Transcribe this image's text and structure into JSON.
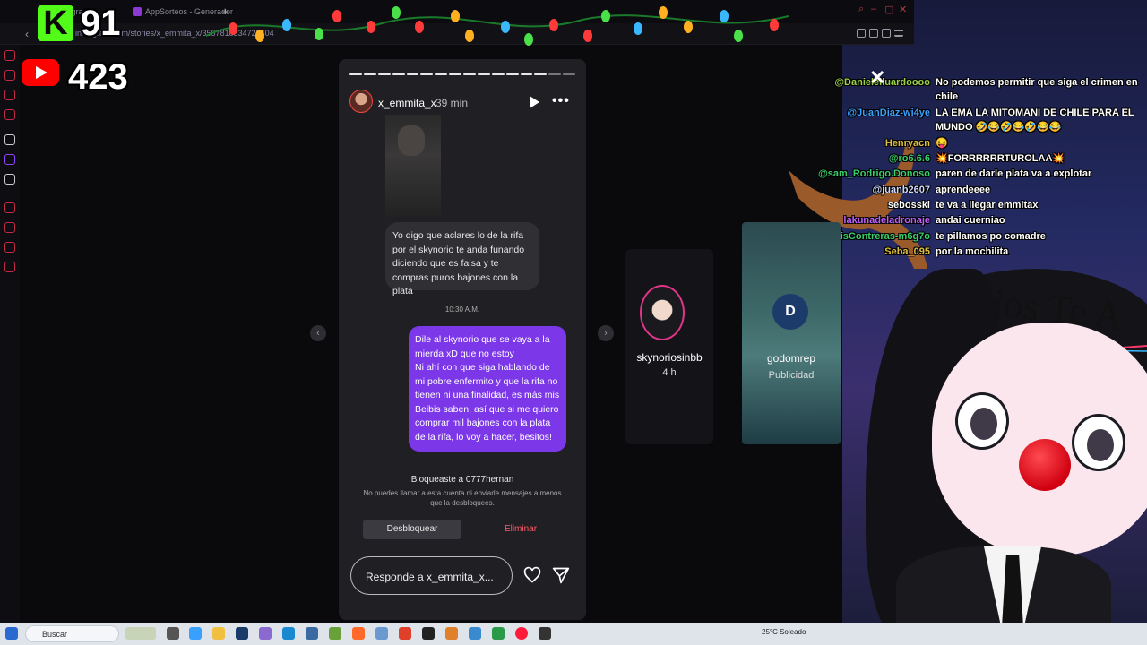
{
  "browser": {
    "tabs": [
      {
        "label": "Instagram"
      },
      {
        "label": "AppSorteos - Generador"
      }
    ],
    "url": "instagram.com/stories/x_emmita_x/3567818334725404"
  },
  "overlay": {
    "kick_logo": "K",
    "kick_count": "91",
    "youtube_count": "423"
  },
  "story": {
    "username": "x_emmita_x",
    "time_ago": "39 min",
    "incoming_message": "Yo digo que aclares lo de la rifa por el skynorio te anda funando diciendo que es falsa y te compras puros bajones con la plata",
    "message_time": "10:30 A.M.",
    "outgoing_message_1": "Dile al skynorio que se vaya a la mierda xD que no estoy",
    "outgoing_message_2": "Ni ahí con que siga hablando de mi pobre enfermito y que la rifa no tienen ni una finalidad, es más mis Beibis saben, así que si me quiero comprar mil bajones con la plata de la rifa, lo voy a hacer, besitos!",
    "blocked_title": "Bloqueaste a 0777hernan",
    "blocked_desc": "No puedes llamar a esta cuenta ni enviarle mensajes a menos que la desbloquees.",
    "unblock_label": "Desbloquear",
    "delete_label": "Eliminar",
    "reply_placeholder": "Responde a x_emmita_x...",
    "progress_segments": 16,
    "progress_watched": 14
  },
  "next_stories": [
    {
      "name": "skynoriosinbb",
      "sub": "4 h"
    },
    {
      "name": "godomrep",
      "sub": "Publicidad",
      "logo": "D"
    }
  ],
  "stream": {
    "banner_text": "Dios Te A"
  },
  "chat": [
    {
      "user": "@Danielelluardoooo",
      "color": "#9ad14a",
      "msg": "No podemos permitir que siga el crimen en chile"
    },
    {
      "user": "@JuanDiaz-wi4ye",
      "color": "#3aa0ff",
      "msg": "LA EMA LA MITOMANI DE CHILE PARA EL MUNDO 🤣😂🤣😂🤣😂😂"
    },
    {
      "user": "Henryacn",
      "color": "#e0c040",
      "msg": "😝"
    },
    {
      "user": "@ro6.6.6",
      "color": "#3acf6a",
      "msg": "💥FORRRRRRTUROLAA💥"
    },
    {
      "user": "@sam_Rodrigo.Donoso",
      "color": "#3acf6a",
      "msg": "paren de darle plata va a explotar"
    },
    {
      "user": "@juanb2607",
      "color": "#cfd8ff",
      "msg": "aprendeeee"
    },
    {
      "user": "sebosski",
      "color": "#ffffff",
      "msg": "te va a llegar emmitax"
    },
    {
      "user": "lakunadeladronaje",
      "color": "#c060ff",
      "msg": "andai cuerniao"
    },
    {
      "user": "@LuisContreras-m6g7o",
      "color": "#3acf6a",
      "msg": "te pillamos po comadre"
    },
    {
      "user": "Seba_095",
      "color": "#e0c040",
      "msg": "por la mochilita"
    }
  ],
  "taskbar": {
    "search_label": "Buscar",
    "weather": "25°C  Soleado"
  }
}
